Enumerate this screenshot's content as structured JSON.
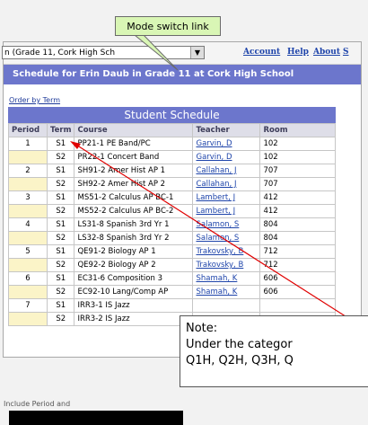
{
  "topbar": {
    "select_value": "n (Grade 11, Cork High Sch",
    "links": [
      "Account",
      "Help",
      "About",
      "S"
    ]
  },
  "banner": {
    "title": "Schedule for Erin Daub in Grade 11 at Cork High School"
  },
  "order_link": "Order by Term",
  "callout": "Mode switch link",
  "schedule": {
    "caption": "Student Schedule",
    "headers": [
      "Period",
      "Term",
      "Course",
      "Teacher",
      "Room"
    ],
    "rows": [
      {
        "period": "1",
        "term": "S1",
        "course": "PP21-1 PE Band/PC",
        "teacher": "Garvin, D",
        "room": "102"
      },
      {
        "period": "",
        "term": "S2",
        "course": "PR22-1 Concert Band",
        "teacher": "Garvin, D",
        "room": "102"
      },
      {
        "period": "2",
        "term": "S1",
        "course": "SH91-2 Amer Hist AP 1",
        "teacher": "Callahan, J",
        "room": "707"
      },
      {
        "period": "",
        "term": "S2",
        "course": "SH92-2 Amer Hist AP 2",
        "teacher": "Callahan, J",
        "room": "707"
      },
      {
        "period": "3",
        "term": "S1",
        "course": "MS51-2 Calculus AP BC-1",
        "teacher": "Lambert, J",
        "room": "412"
      },
      {
        "period": "",
        "term": "S2",
        "course": "MS52-2 Calculus AP BC-2",
        "teacher": "Lambert, J",
        "room": "412"
      },
      {
        "period": "4",
        "term": "S1",
        "course": "LS31-8 Spanish 3rd Yr 1",
        "teacher": "Salamon, S",
        "room": "804"
      },
      {
        "period": "",
        "term": "S2",
        "course": "LS32-8 Spanish 3rd Yr 2",
        "teacher": "Salamon, S",
        "room": "804"
      },
      {
        "period": "5",
        "term": "S1",
        "course": "QE91-2 Biology AP 1",
        "teacher": "Trakovsky, B",
        "room": "712"
      },
      {
        "period": "",
        "term": "S2",
        "course": "QE92-2 Biology AP 2",
        "teacher": "Trakovsky, B",
        "room": "712"
      },
      {
        "period": "6",
        "term": "S1",
        "course": "EC31-6 Composition 3",
        "teacher": "Shamah, K",
        "room": "606"
      },
      {
        "period": "",
        "term": "S2",
        "course": "EC92-10 Lang/Comp AP",
        "teacher": "Shamah, K",
        "room": "606"
      },
      {
        "period": "7",
        "term": "S1",
        "course": "IRR3-1 IS Jazz",
        "teacher": "",
        "room": ""
      },
      {
        "period": "",
        "term": "S2",
        "course": "IRR3-2 IS Jazz",
        "teacher": "",
        "room": ""
      }
    ]
  },
  "note": {
    "line1": "Note:",
    "line2": "Under the categor",
    "line3": "Q1H, Q2H, Q3H, Q"
  },
  "bottom_text": "Include Period and"
}
